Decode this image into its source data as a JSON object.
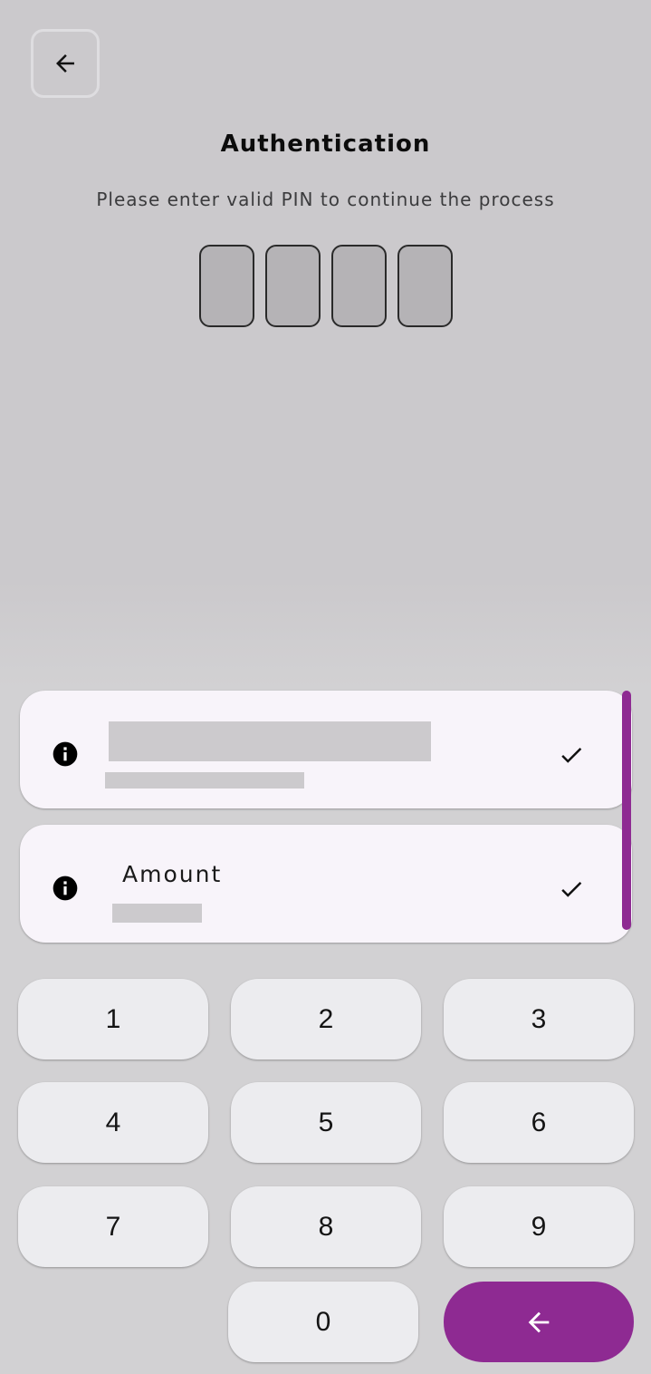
{
  "header": {
    "title": "Authentication",
    "subtitle": "Please enter valid PIN to continue the process",
    "back_icon": "arrow-left-icon"
  },
  "pin": {
    "length": 4,
    "entered": [
      "",
      "",
      "",
      ""
    ]
  },
  "info_cards": [
    {
      "label": "",
      "value": "",
      "icon": "info-icon",
      "status_icon": "check-icon",
      "redacted": true
    },
    {
      "label": "Amount",
      "value": "",
      "icon": "info-icon",
      "status_icon": "check-icon",
      "redacted": true
    }
  ],
  "keypad": {
    "keys": [
      "1",
      "2",
      "3",
      "4",
      "5",
      "6",
      "7",
      "8",
      "9",
      "0"
    ],
    "backspace_icon": "arrow-left-icon"
  },
  "colors": {
    "accent": "#8e2a92",
    "card_background": "#f8f4fa",
    "key_background": "#ececef",
    "page_background": "#cbc9cc"
  }
}
